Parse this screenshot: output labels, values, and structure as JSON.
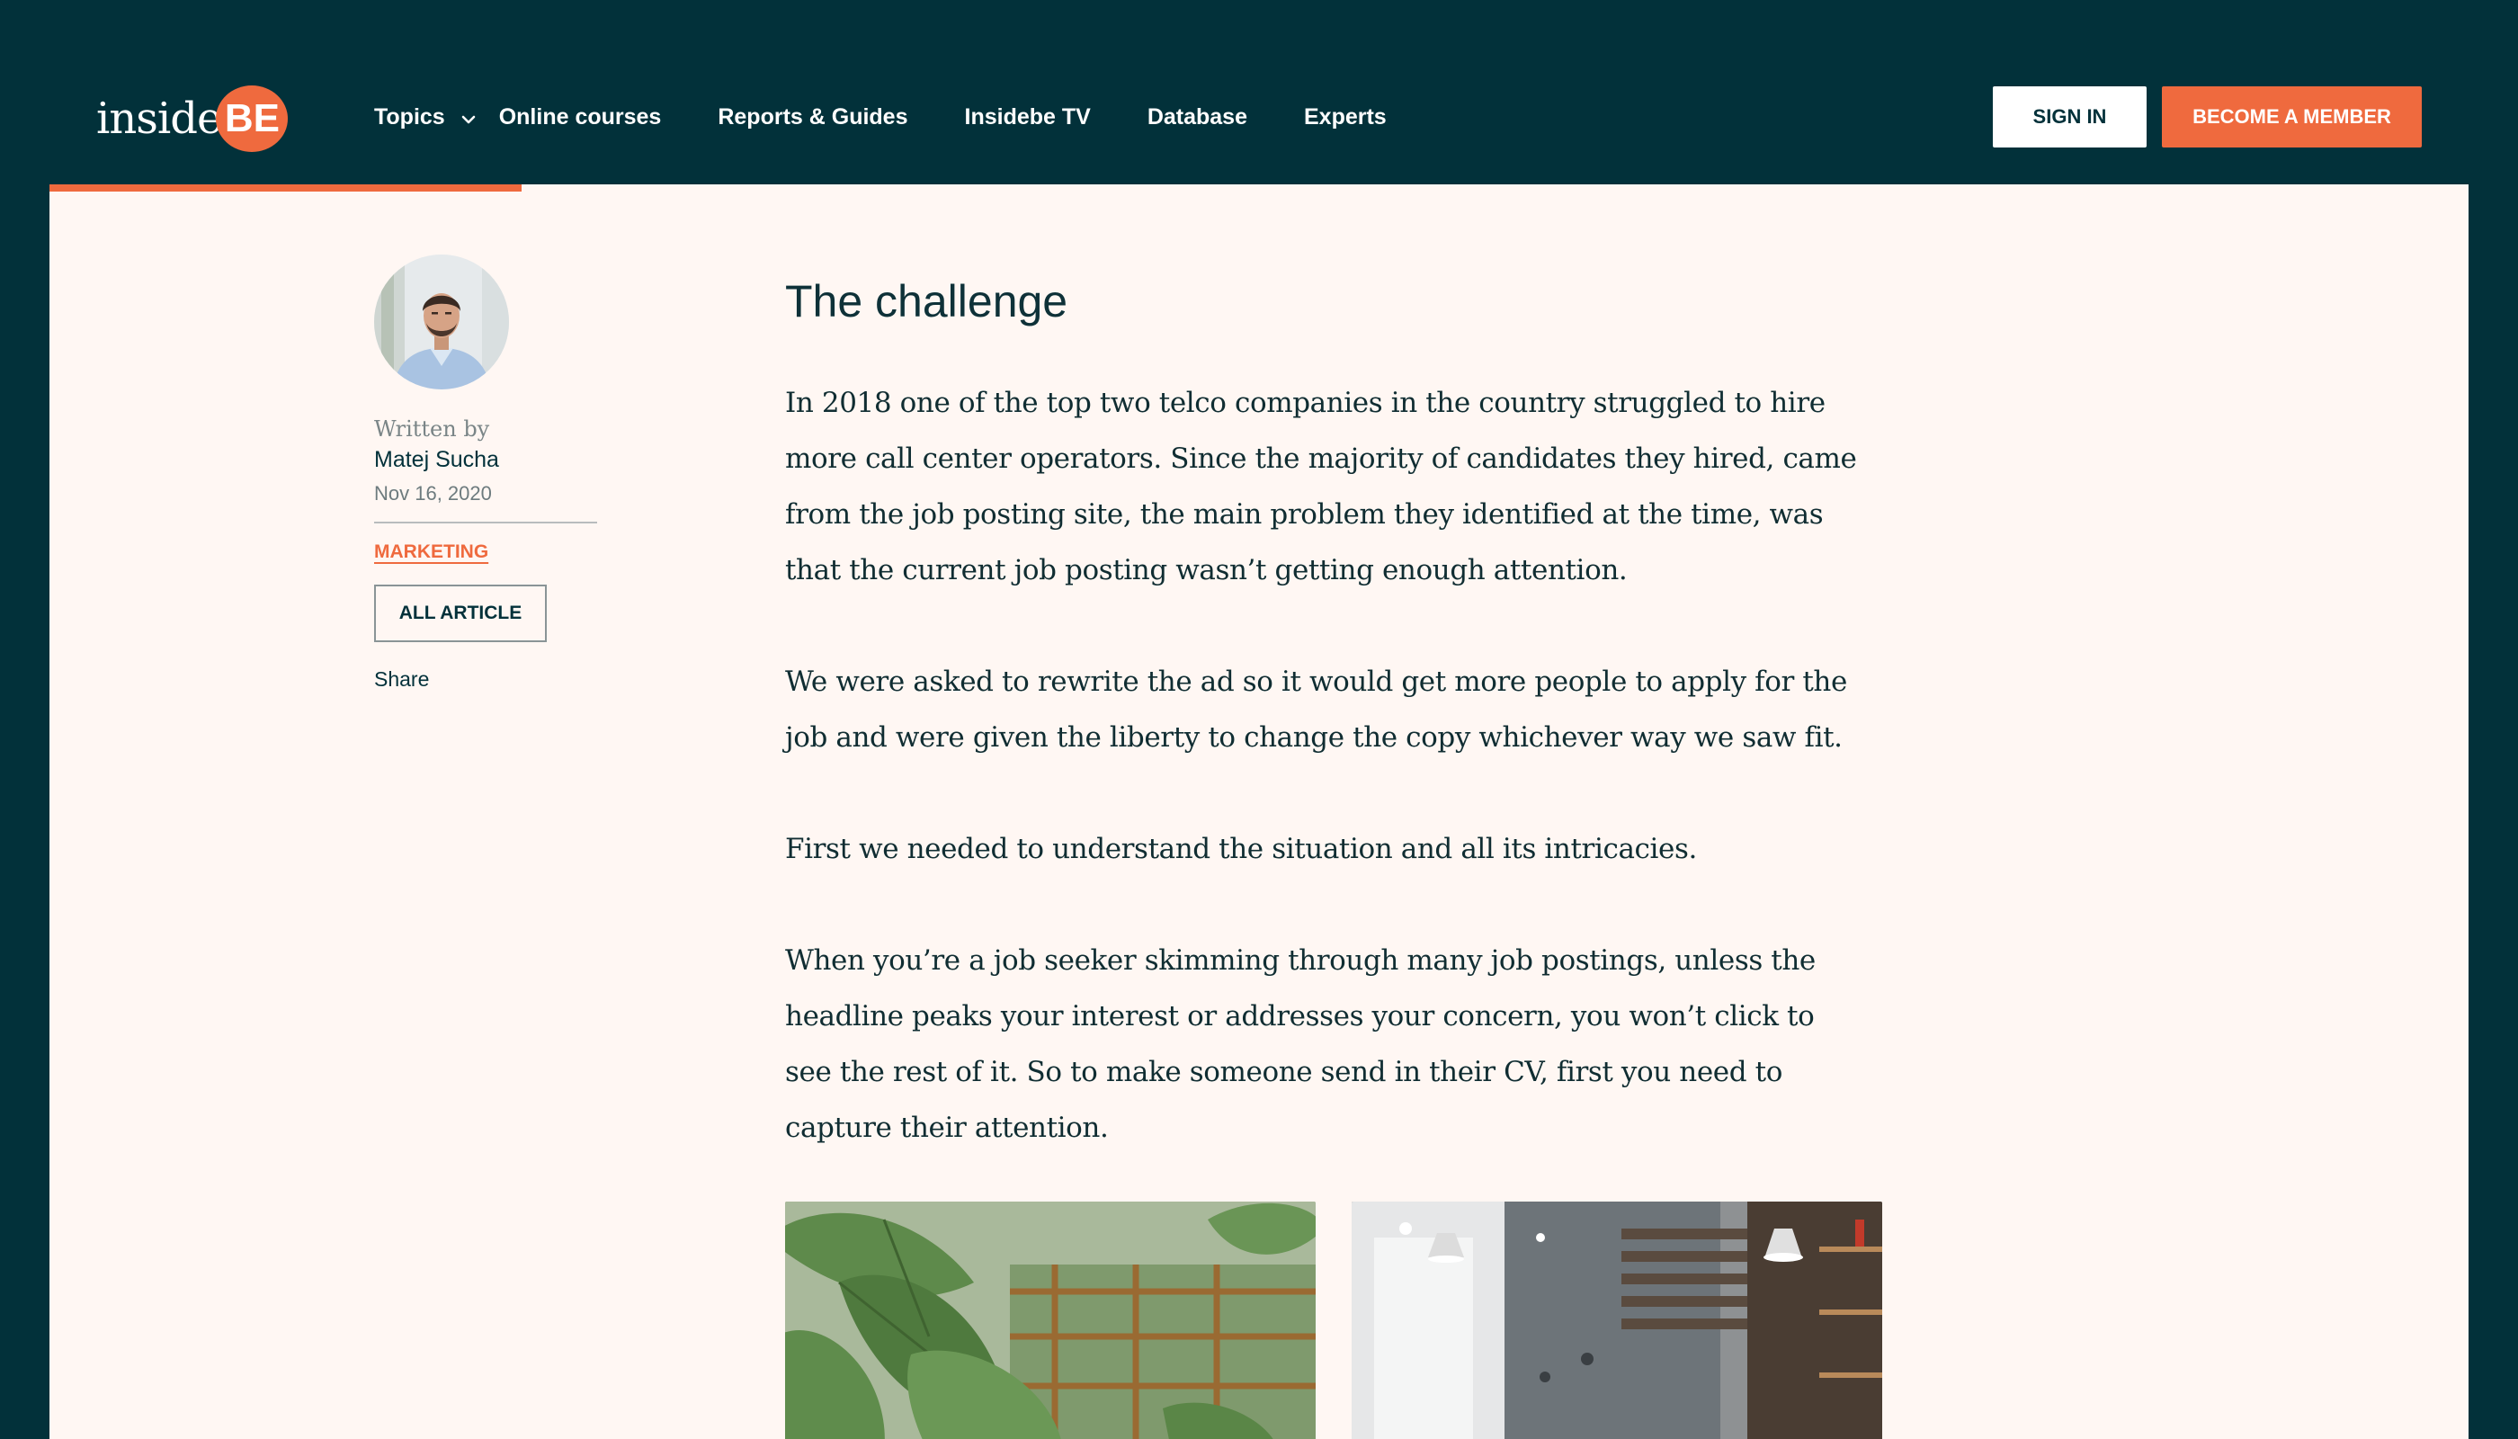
{
  "header": {
    "logo": {
      "text": "inside",
      "badge": "BE"
    },
    "nav": [
      {
        "label": "Topics",
        "icon": "chevron-down-icon"
      },
      {
        "label": "Online courses"
      },
      {
        "label": "Reports & Guides"
      },
      {
        "label": "Insidebe TV"
      },
      {
        "label": "Database"
      },
      {
        "label": "Experts"
      }
    ],
    "sign_in": "SIGN IN",
    "become_member": "BECOME A MEMBER"
  },
  "reading_progress": 0.195,
  "sidebar": {
    "written_by": "Written by",
    "author": "Matej Sucha",
    "date": "Nov 16, 2020",
    "category": "MARKETING",
    "all_article": "ALL ARTICLE",
    "share": "Share"
  },
  "article": {
    "heading": "The challenge",
    "paragraphs": [
      "In 2018 one of the top two telco companies in the country struggled to hire more call center operators. Since the majority of candidates they hired, came from the job posting site, the main problem they identified at the time, was that the current job posting wasn’t getting enough attention.",
      "We were asked to rewrite the ad so it would get more people to apply for the job and were given the liberty to change the copy whichever way we saw fit.",
      "First we needed to understand the situation and all its intricacies.",
      "When you’re a job seeker skimming through many job postings, unless the headline peaks your interest or addresses your concern, you won’t click to see the rest of it.  So to make someone send in their CV, first you need to capture their attention."
    ]
  },
  "colors": {
    "navy": "#02313a",
    "accent": "#ef6a3e",
    "page_bg": "#fff7f3"
  }
}
